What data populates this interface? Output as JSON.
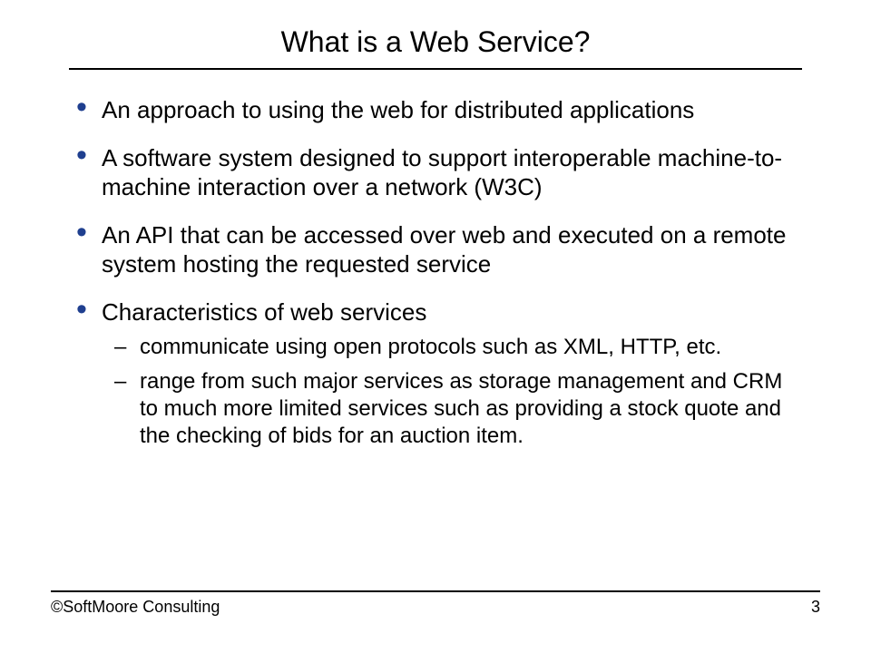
{
  "title": "What is a Web Service?",
  "bullets": [
    {
      "text": "An approach to using the web for distributed applications"
    },
    {
      "text": "A software system designed to support interoperable machine-to-machine interaction over a network (W3C)"
    },
    {
      "text": "An API that can be accessed over web and executed on a remote system hosting the requested service"
    },
    {
      "text": "Characteristics of web services",
      "sub": [
        "communicate using open protocols such as XML, HTTP, etc.",
        "range from such major services as storage management and CRM to much more limited services such as providing a stock quote and the checking of bids for an auction item."
      ]
    }
  ],
  "footer": {
    "copyright": "©SoftMoore Consulting",
    "page": "3"
  }
}
